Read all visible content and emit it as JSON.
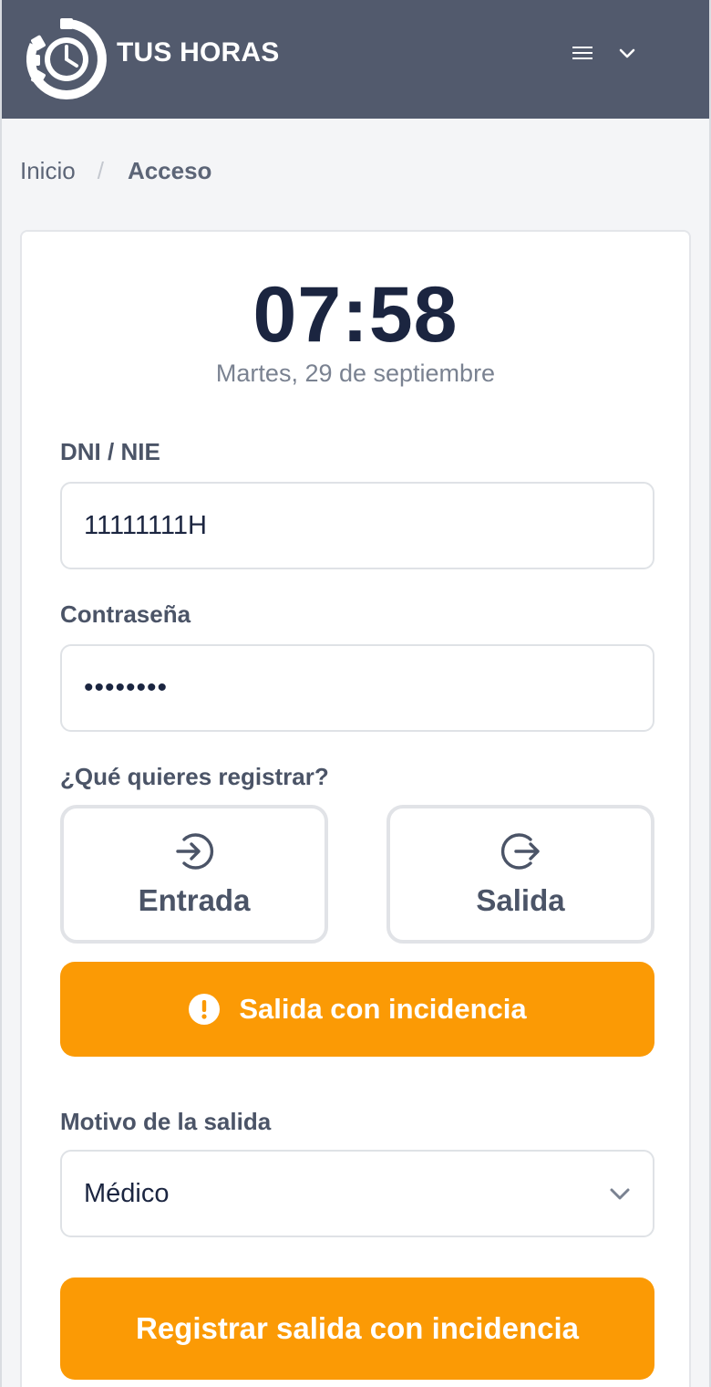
{
  "header": {
    "brand": "TUS HORAS",
    "logo_icon": "clock-gear-logo",
    "menu_icon": "hamburger-menu-icon",
    "dropdown_icon": "chevron-down-icon"
  },
  "breadcrumb": {
    "home": "Inicio",
    "separator": "/",
    "current": "Acceso"
  },
  "clock": {
    "time": "07:58",
    "date": "Martes, 29 de septiembre"
  },
  "form": {
    "dni_label": "DNI / NIE",
    "dni_value": "11111111H",
    "password_label": "Contraseña",
    "password_value": "••••••••",
    "register_question": "¿Qué quieres registrar?",
    "entry_label": "Entrada",
    "entry_icon": "login-arrow-icon",
    "exit_label": "Salida",
    "exit_icon": "logout-arrow-icon",
    "incident_label": "Salida con incidencia",
    "incident_icon": "alert-circle-icon",
    "reason_label": "Motivo de la salida",
    "reason_value": "Médico",
    "submit_label": "Registrar salida con incidencia"
  },
  "colors": {
    "header_bg": "#525a6d",
    "accent_orange": "#fb9a05",
    "text_dark": "#1b2540",
    "text_label": "#4b5467"
  }
}
